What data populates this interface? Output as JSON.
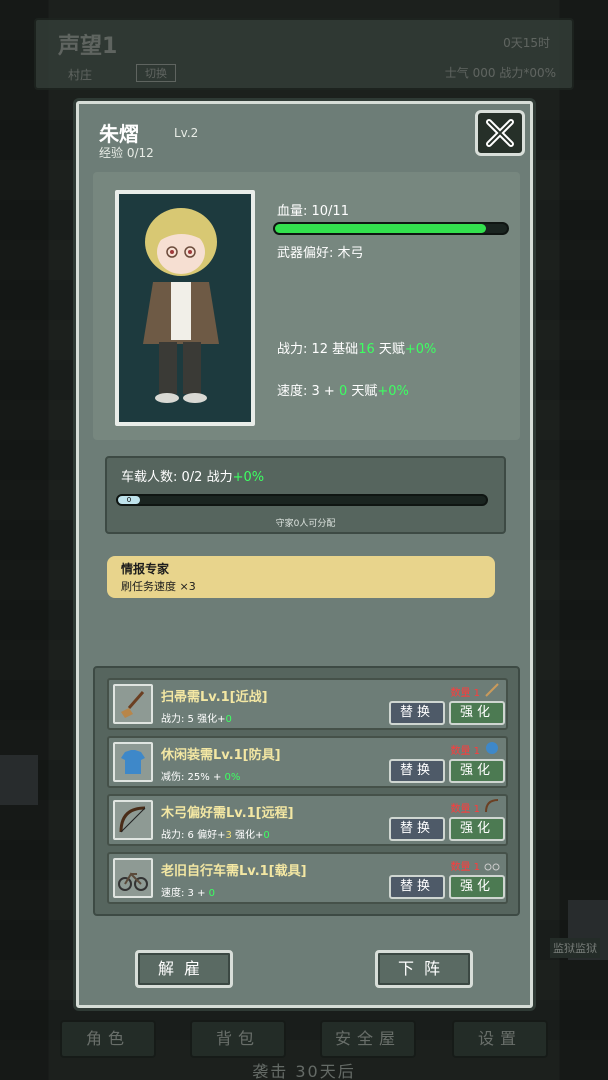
{
  "hud": {
    "title": "声望1",
    "village_label": "村庄",
    "switch_label": "切换",
    "day": "0天15时",
    "stats": "士气 000   战力*00%"
  },
  "background": {
    "prison_sign": "监狱监狱"
  },
  "character": {
    "name": "朱熠",
    "level": "Lv.2",
    "exp": "经验 0/12",
    "hp_label": "血量: 10/11",
    "hp_fraction": 0.91,
    "weapon_pref": "武器偏好: 木弓",
    "power_prefix": "战力: 12  基础",
    "power_base": "16",
    "power_talent_label": "天赋",
    "power_talent_value": "+0%",
    "speed_prefix": "速度: 3  +",
    "speed_bonus": "0",
    "speed_talent_label": "天赋",
    "speed_talent_value": "+0%"
  },
  "cargo": {
    "title": "车载人数: 0/2    战力",
    "title_value": "+0%",
    "bar_value": "0",
    "hint": "守家0人可分配"
  },
  "talent": {
    "name": "情报专家",
    "desc": "刷任务速度  ×3"
  },
  "equipment": [
    {
      "name": "扫帚需Lv.1[近战]",
      "stat": "战力: 5  强化+",
      "stat_bonus": "0",
      "count": "数量 1",
      "icon": "broom-icon",
      "replace": "替换",
      "upgrade": "强化"
    },
    {
      "name": "休闲装需Lv.1[防具]",
      "stat": "减伤: 25% + ",
      "stat_bonus": "0%",
      "count": "数量 1",
      "icon": "clothes-icon",
      "replace": "替换",
      "upgrade": "强化"
    },
    {
      "name": "木弓偏好需Lv.1[远程]",
      "stat": "战力: 6  偏好+",
      "stat_bonus": "3",
      "stat_extra": "  强化+",
      "stat_extra_bonus": "0",
      "count": "数量 1",
      "icon": "bow-icon",
      "replace": "替换",
      "upgrade": "强化"
    },
    {
      "name": "老旧自行车需Lv.1[载具]",
      "stat": "速度: 3  +  ",
      "stat_bonus": "0",
      "count": "数量 1",
      "icon": "bicycle-icon",
      "replace": "替换",
      "upgrade": "强化"
    }
  ],
  "actions": {
    "dismiss": "解雇",
    "deploy": "下阵"
  },
  "nav": {
    "role": "角色",
    "bag": "背包",
    "safehouse": "安全屋",
    "settings": "设置"
  },
  "attack_note": "袭击  30天后",
  "colors": {
    "accent_green": "#3dff62",
    "hp_bar": "#33e04e",
    "talent_bg": "#e8d48c",
    "equip_name": "#f3e7a3"
  }
}
